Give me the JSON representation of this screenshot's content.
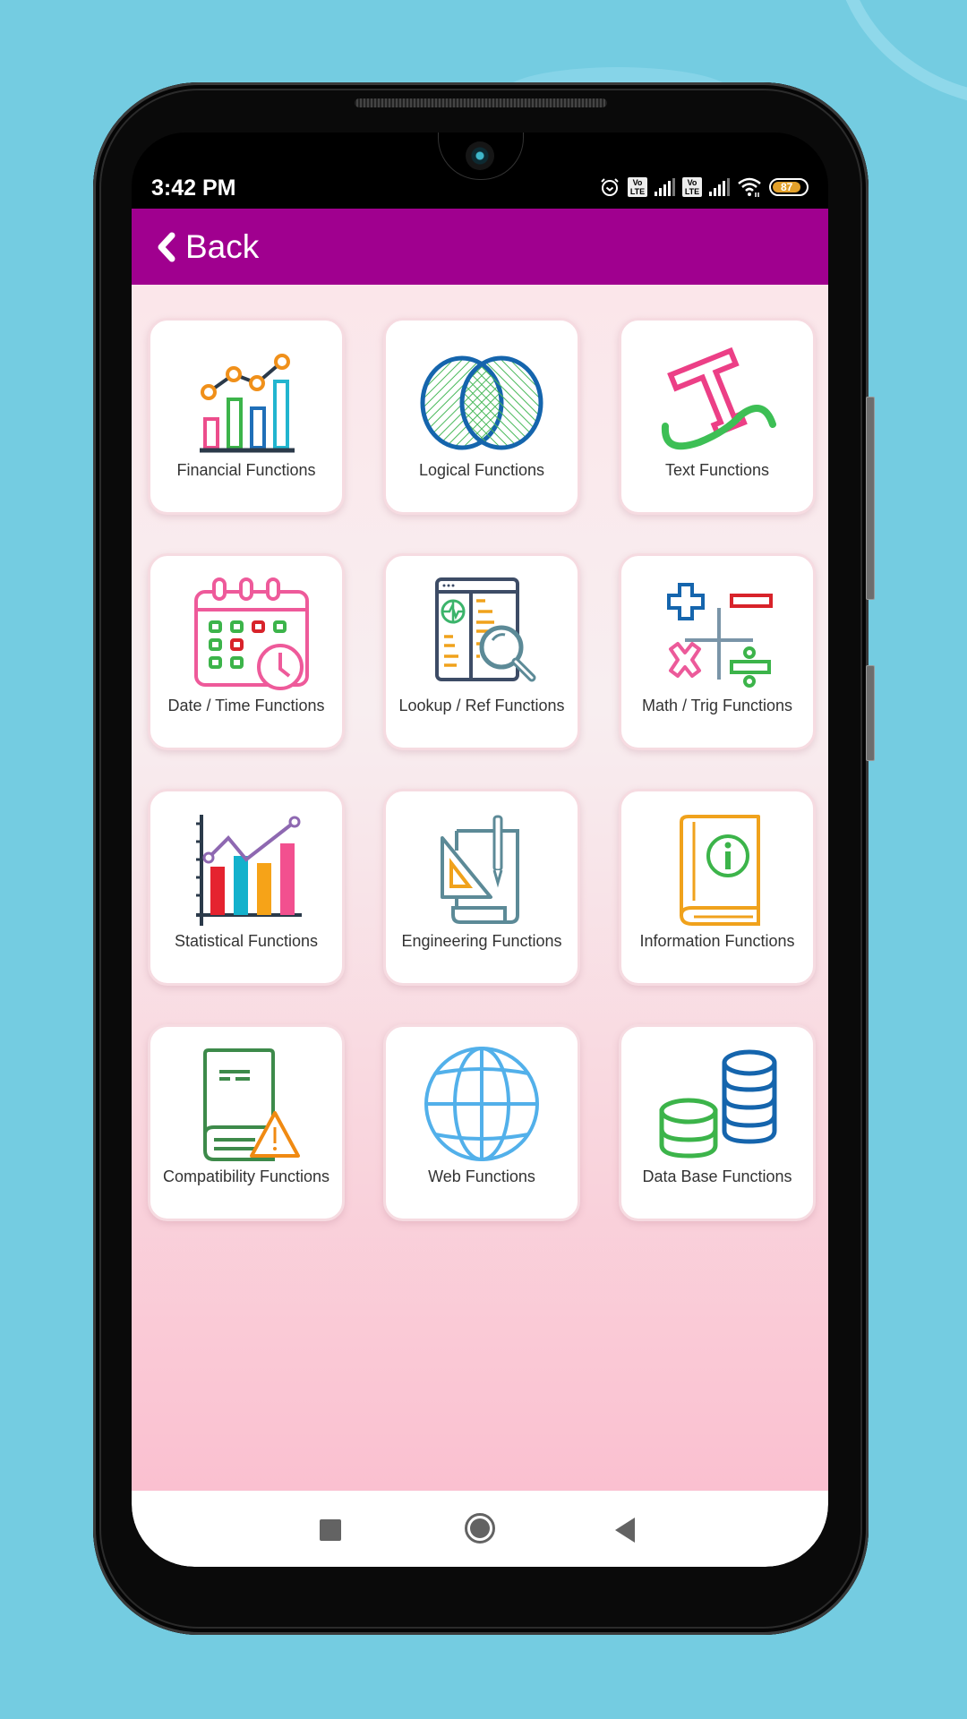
{
  "status_bar": {
    "time": "3:42 PM",
    "volte_label_1": "Vo\nLTE",
    "volte_label_2": "Vo\nLTE",
    "battery_level": "87",
    "icons": [
      "alarm-icon",
      "volte-icon",
      "signal-icon",
      "volte-icon",
      "signal-icon",
      "wifi-icon",
      "battery-icon"
    ]
  },
  "app_bar": {
    "back_label": "Back",
    "back_icon": "chevron-left-icon",
    "background_color": "#a0008f"
  },
  "categories": [
    {
      "label": "Financial Functions",
      "icon": "bar-line-chart-icon"
    },
    {
      "label": "Logical Functions",
      "icon": "venn-diagram-icon"
    },
    {
      "label": "Text Functions",
      "icon": "text-t-icon"
    },
    {
      "label": "Date / Time Functions",
      "icon": "calendar-clock-icon"
    },
    {
      "label": "Lookup / Ref Functions",
      "icon": "document-search-icon"
    },
    {
      "label": "Math / Trig Functions",
      "icon": "math-operators-icon"
    },
    {
      "label": "Statistical Functions",
      "icon": "statistics-chart-icon"
    },
    {
      "label": "Engineering Functions",
      "icon": "engineering-tools-icon"
    },
    {
      "label": "Information Functions",
      "icon": "info-book-icon"
    },
    {
      "label": "Compatibility Functions",
      "icon": "book-warning-icon"
    },
    {
      "label": "Web Functions",
      "icon": "globe-icon"
    },
    {
      "label": "Data Base Functions",
      "icon": "database-icon"
    }
  ],
  "nav_bar": {
    "buttons": [
      "recent-apps",
      "home",
      "back"
    ]
  }
}
